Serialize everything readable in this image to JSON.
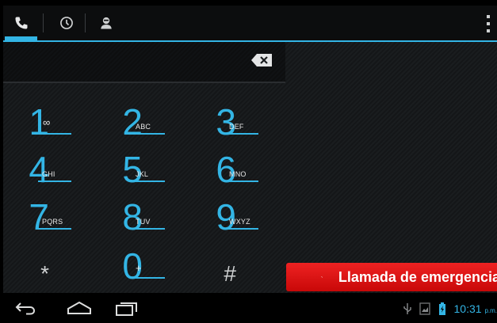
{
  "tabs": [
    {
      "name": "phone",
      "icon": "phone-icon",
      "active": true
    },
    {
      "name": "recent",
      "icon": "clock-icon",
      "active": false
    },
    {
      "name": "contacts",
      "icon": "person-icon",
      "active": false
    }
  ],
  "menu": {
    "icon": "overflow-menu-icon"
  },
  "dialer": {
    "digits_value": "",
    "backspace_icon": "backspace-icon"
  },
  "keypad": {
    "k1": {
      "num": "1",
      "sub": "∞"
    },
    "k2": {
      "num": "2",
      "sub": "ABC"
    },
    "k3": {
      "num": "3",
      "sub": "DEF"
    },
    "k4": {
      "num": "4",
      "sub": "GHI"
    },
    "k5": {
      "num": "5",
      "sub": "JKL"
    },
    "k6": {
      "num": "6",
      "sub": "MNO"
    },
    "k7": {
      "num": "7",
      "sub": "PQRS"
    },
    "k8": {
      "num": "8",
      "sub": "TUV"
    },
    "k9": {
      "num": "9",
      "sub": "WXYZ"
    },
    "kstar": {
      "num": "*"
    },
    "k0": {
      "num": "0",
      "sub": "+"
    },
    "khash": {
      "num": "#"
    }
  },
  "emergency": {
    "label": "Llamada de emergencia",
    "icon": "phone-handset-icon"
  },
  "navbar": {
    "back_icon": "back-icon",
    "home_icon": "home-icon",
    "recents_icon": "recent-apps-icon"
  },
  "status": {
    "usb_icon": "usb-icon",
    "image_icon": "gallery-notification-icon",
    "battery_icon": "battery-icon",
    "time": "10:31",
    "ampm": "p.m."
  },
  "colors": {
    "accent": "#33b5e5",
    "emergency": "#e01b1b",
    "background": "#1a1d1f"
  }
}
